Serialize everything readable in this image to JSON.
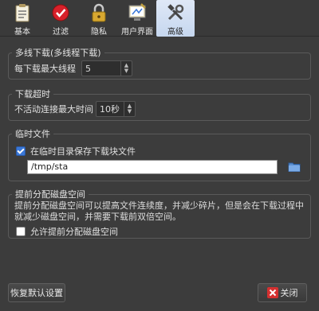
{
  "tabs": [
    {
      "label": "基本",
      "icon": "clipboard-icon"
    },
    {
      "label": "过滤",
      "icon": "forbidden-icon"
    },
    {
      "label": "隐私",
      "icon": "lock-icon"
    },
    {
      "label": "用户界面",
      "icon": "desktop-paint-icon"
    },
    {
      "label": "高级",
      "icon": "tools-icon"
    }
  ],
  "active_tab": "高级",
  "multithread": {
    "title": "多线下载(多线程下载)",
    "max_label": "每下载最大线程",
    "max_value": "5"
  },
  "timeout": {
    "title": "下载超时",
    "label": "不活动连接最大时间",
    "value": "10秒"
  },
  "tempfiles": {
    "title": "临时文件",
    "checkbox_label": "在临时目录保存下载块文件",
    "checked": true,
    "path": "/tmp/sta"
  },
  "prealloc": {
    "title": "提前分配磁盘空间",
    "description": "提前分配磁盘空间可以提高文件连续度，并减少碎片，但是会在下载过程中就减少磁盘空间，并需要下载前双倍空间。",
    "checkbox_label": "允许提前分配磁盘空间",
    "checked": false
  },
  "buttons": {
    "restore_defaults": "恢复默认设置",
    "close": "关闭"
  }
}
